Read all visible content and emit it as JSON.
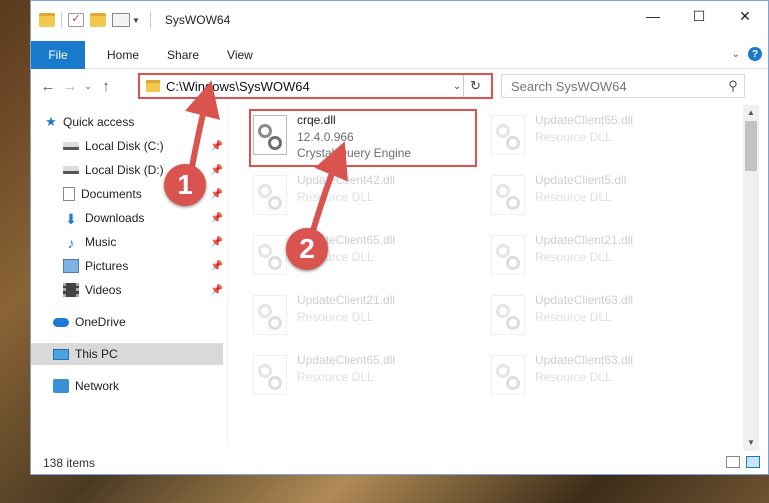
{
  "window": {
    "title": "SysWOW64",
    "controls": {
      "minimize": "—",
      "maximize": "☐",
      "close": "✕"
    }
  },
  "ribbon": {
    "tabs": [
      "File",
      "Home",
      "Share",
      "View"
    ],
    "collapse_icon": "chevron-down-icon",
    "help_icon": "?"
  },
  "address_bar": {
    "path": "C:\\Windows\\SysWOW64",
    "search_placeholder": "Search SysWOW64"
  },
  "sidebar": {
    "quick_access": "Quick access",
    "items": [
      {
        "label": "Local Disk (C:)",
        "pinned": true
      },
      {
        "label": "Local Disk (D:)",
        "pinned": true
      },
      {
        "label": "Documents",
        "pinned": true
      },
      {
        "label": "Downloads",
        "pinned": true
      },
      {
        "label": "Music",
        "pinned": true
      },
      {
        "label": "Pictures",
        "pinned": true
      },
      {
        "label": "Videos",
        "pinned": true
      }
    ],
    "onedrive": "OneDrive",
    "this_pc": "This PC",
    "network": "Network"
  },
  "files": [
    {
      "name": "crqe.dll",
      "version": "12.4.0.966",
      "desc": "Crystal Query Engine"
    },
    {
      "name": "UpdateClient65.dll",
      "desc": "Resource DLL"
    },
    {
      "name": "UpdateClient42.dll",
      "desc": "Resource DLL"
    },
    {
      "name": "UpdateClient5.dll",
      "desc": "Resource DLL"
    },
    {
      "name": "UpdateClient65.dll",
      "desc": "Resource DLL"
    },
    {
      "name": "UpdateClient21.dll",
      "desc": "Resource DLL"
    },
    {
      "name": "UpdateClient21.dll",
      "desc": "Resource DLL"
    },
    {
      "name": "UpdateClient63.dll",
      "desc": "Resource DLL"
    },
    {
      "name": "UpdateClient65.dll",
      "desc": "Resource DLL"
    },
    {
      "name": "UpdateClient63.dll",
      "desc": "Resource DLL"
    }
  ],
  "status": {
    "item_count": "138 items"
  },
  "annotations": {
    "step1": "1",
    "step2": "2",
    "color": "#d9534f"
  }
}
